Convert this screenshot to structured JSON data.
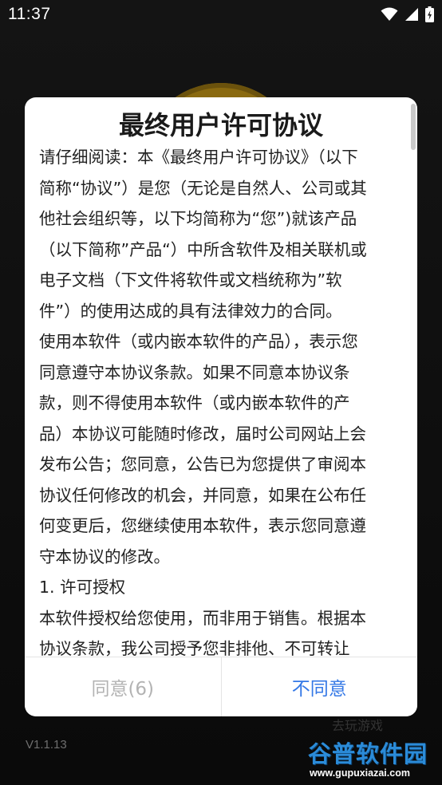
{
  "status_bar": {
    "time": "11:37",
    "icons": [
      "wifi-icon",
      "cellular-signal-icon",
      "battery-charging-icon"
    ]
  },
  "background": {
    "version": "V1.1.13",
    "faded_text": "去玩游戏"
  },
  "dialog": {
    "title": "最终用户许可协议",
    "paragraphs": [
      "请仔细阅读：本《最终用户许可协议》（以下\n简称“协议”）是您（无论是自然人、公司或其\n他社会组织等，以下均简称为“您”)就该产品\n（以下简称”产品“）中所含软件及相关联机或\n电子文档（下文件将软件或文档统称为”软\n件”）的使用达成的具有法律效力的合同。",
      "使用本软件（或内嵌本软件的产品），表示您\n同意遵守本协议条款。如果不同意本协议条\n款，则不得使用本软件（或内嵌本软件的产\n品）本协议可能随时修改，届时公司网站上会\n发布公告；您同意，公告已为您提供了审阅本\n协议任何修改的机会，并同意，如果在公布任\n何变更后，您继续使用本软件，表示您同意遵\n守本协议的修改。",
      "1. 许可授权",
      "本软件授权给您使用，而非用于销售。根据本\n协议条款，我公司授予您非排他、不可转让"
    ],
    "agree_label": "同意(6)",
    "disagree_label": "不同意"
  },
  "watermark": {
    "title": "谷普软件园",
    "url": "www.gupuxiazai.com"
  },
  "colors": {
    "accent": "#3478e6",
    "disabled": "#b3b3b3",
    "watermark": "#2b8bd8"
  }
}
